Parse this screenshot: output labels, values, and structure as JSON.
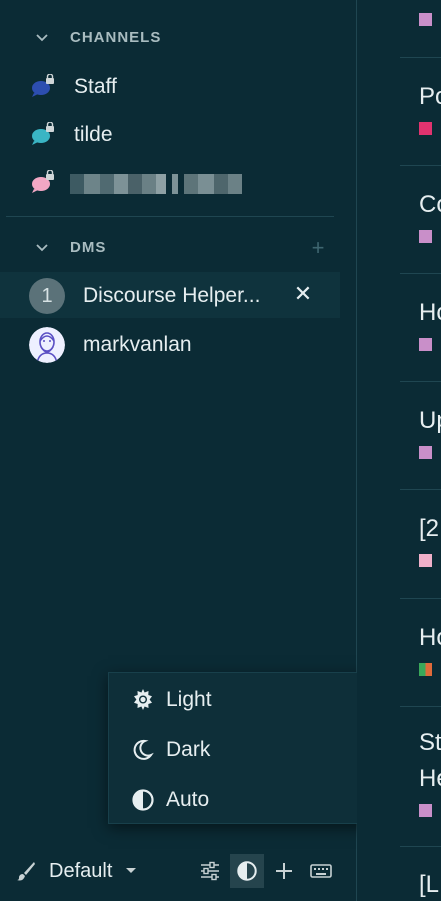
{
  "sidebar": {
    "channels_section": {
      "title": "CHANNELS",
      "items": [
        {
          "label": "Staff",
          "icon": "chat-bubble-lock-icon",
          "color": "#2d4eb0"
        },
        {
          "label": "tilde",
          "icon": "chat-bubble-lock-icon",
          "color": "#3ab5c4"
        },
        {
          "label": "",
          "icon": "chat-bubble-lock-icon",
          "color": "#f2a7c4",
          "obscured": true
        }
      ]
    },
    "dms_section": {
      "title": "DMS",
      "add_label": "+",
      "items": [
        {
          "label": "Discourse Helper...",
          "badge": "1",
          "close_label": "✕",
          "active": true
        },
        {
          "label": "markvanlan",
          "avatar": "user-avatar"
        }
      ]
    }
  },
  "theme_menu": {
    "items": [
      {
        "label": "Light",
        "icon": "sun-icon"
      },
      {
        "label": "Dark",
        "icon": "moon-icon"
      },
      {
        "label": "Auto",
        "icon": "half-circle-icon"
      }
    ]
  },
  "footer": {
    "theme_label": "Default",
    "buttons": [
      "filter-settings-icon",
      "theme-toggle-icon",
      "plus-icon",
      "keyboard-icon"
    ]
  },
  "topics": [
    {
      "title": "",
      "cat_color": "#c98fc9"
    },
    {
      "title": "Po",
      "cat_color": "#e0336f"
    },
    {
      "title": "Co",
      "cat_color": "#c98fc9"
    },
    {
      "title": "Ho",
      "cat_color": "#c98fc9"
    },
    {
      "title": "Up",
      "cat_color": "#c98fc9"
    },
    {
      "title": "[2",
      "cat_color": "#efb0c9"
    },
    {
      "title": "Ho",
      "cat_color": "#e06a3a"
    },
    {
      "title": "St",
      "title2": "He",
      "cat_color": "#c98fc9"
    },
    {
      "title": "[L",
      "cat_color": ""
    }
  ],
  "colors": {
    "background": "#0b2b35",
    "text": "#e6eef0",
    "muted": "#a9bcc0",
    "divider": "#1f4651"
  }
}
